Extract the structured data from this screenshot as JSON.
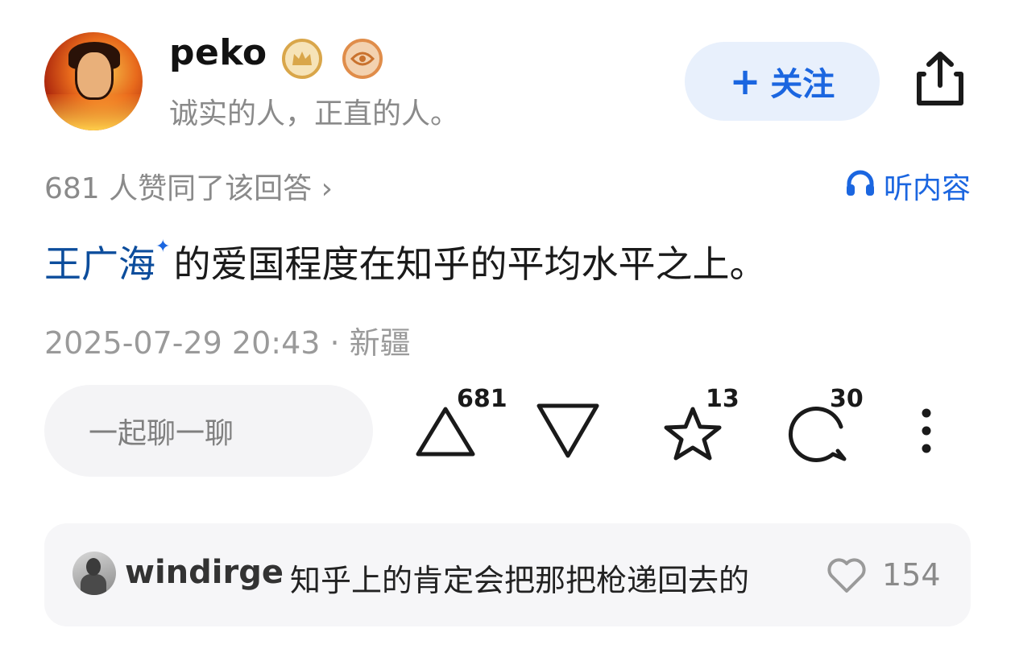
{
  "author": {
    "name": "peko",
    "bio": "诚实的人，正直的人。",
    "badges": [
      "crown-badge-icon",
      "eye-badge-icon"
    ]
  },
  "follow_button": {
    "plus": "+",
    "label": "关注"
  },
  "agree_text": "681 人赞同了该回答 ›",
  "listen": {
    "icon": "headphone-icon",
    "label": "听内容"
  },
  "answer": {
    "link_text": "王广海",
    "link_mark": "✦",
    "text": "的爱国程度在知乎的平均水平之上。"
  },
  "timestamp": "2025-07-29 20:43 · 新疆",
  "chat_placeholder": "一起聊一聊",
  "actions": {
    "upvote_count": "681",
    "favorite_count": "13",
    "comment_count": "30"
  },
  "top_comment": {
    "user": "windirge",
    "text": "知乎上的肯定会把那把枪递回去的",
    "likes": "154"
  },
  "colors": {
    "accent": "#1b66e0",
    "link": "#0c4d9c",
    "muted": "#8a8a8a",
    "follow_bg": "#e8f0fc",
    "pill_bg": "#f4f4f6"
  }
}
